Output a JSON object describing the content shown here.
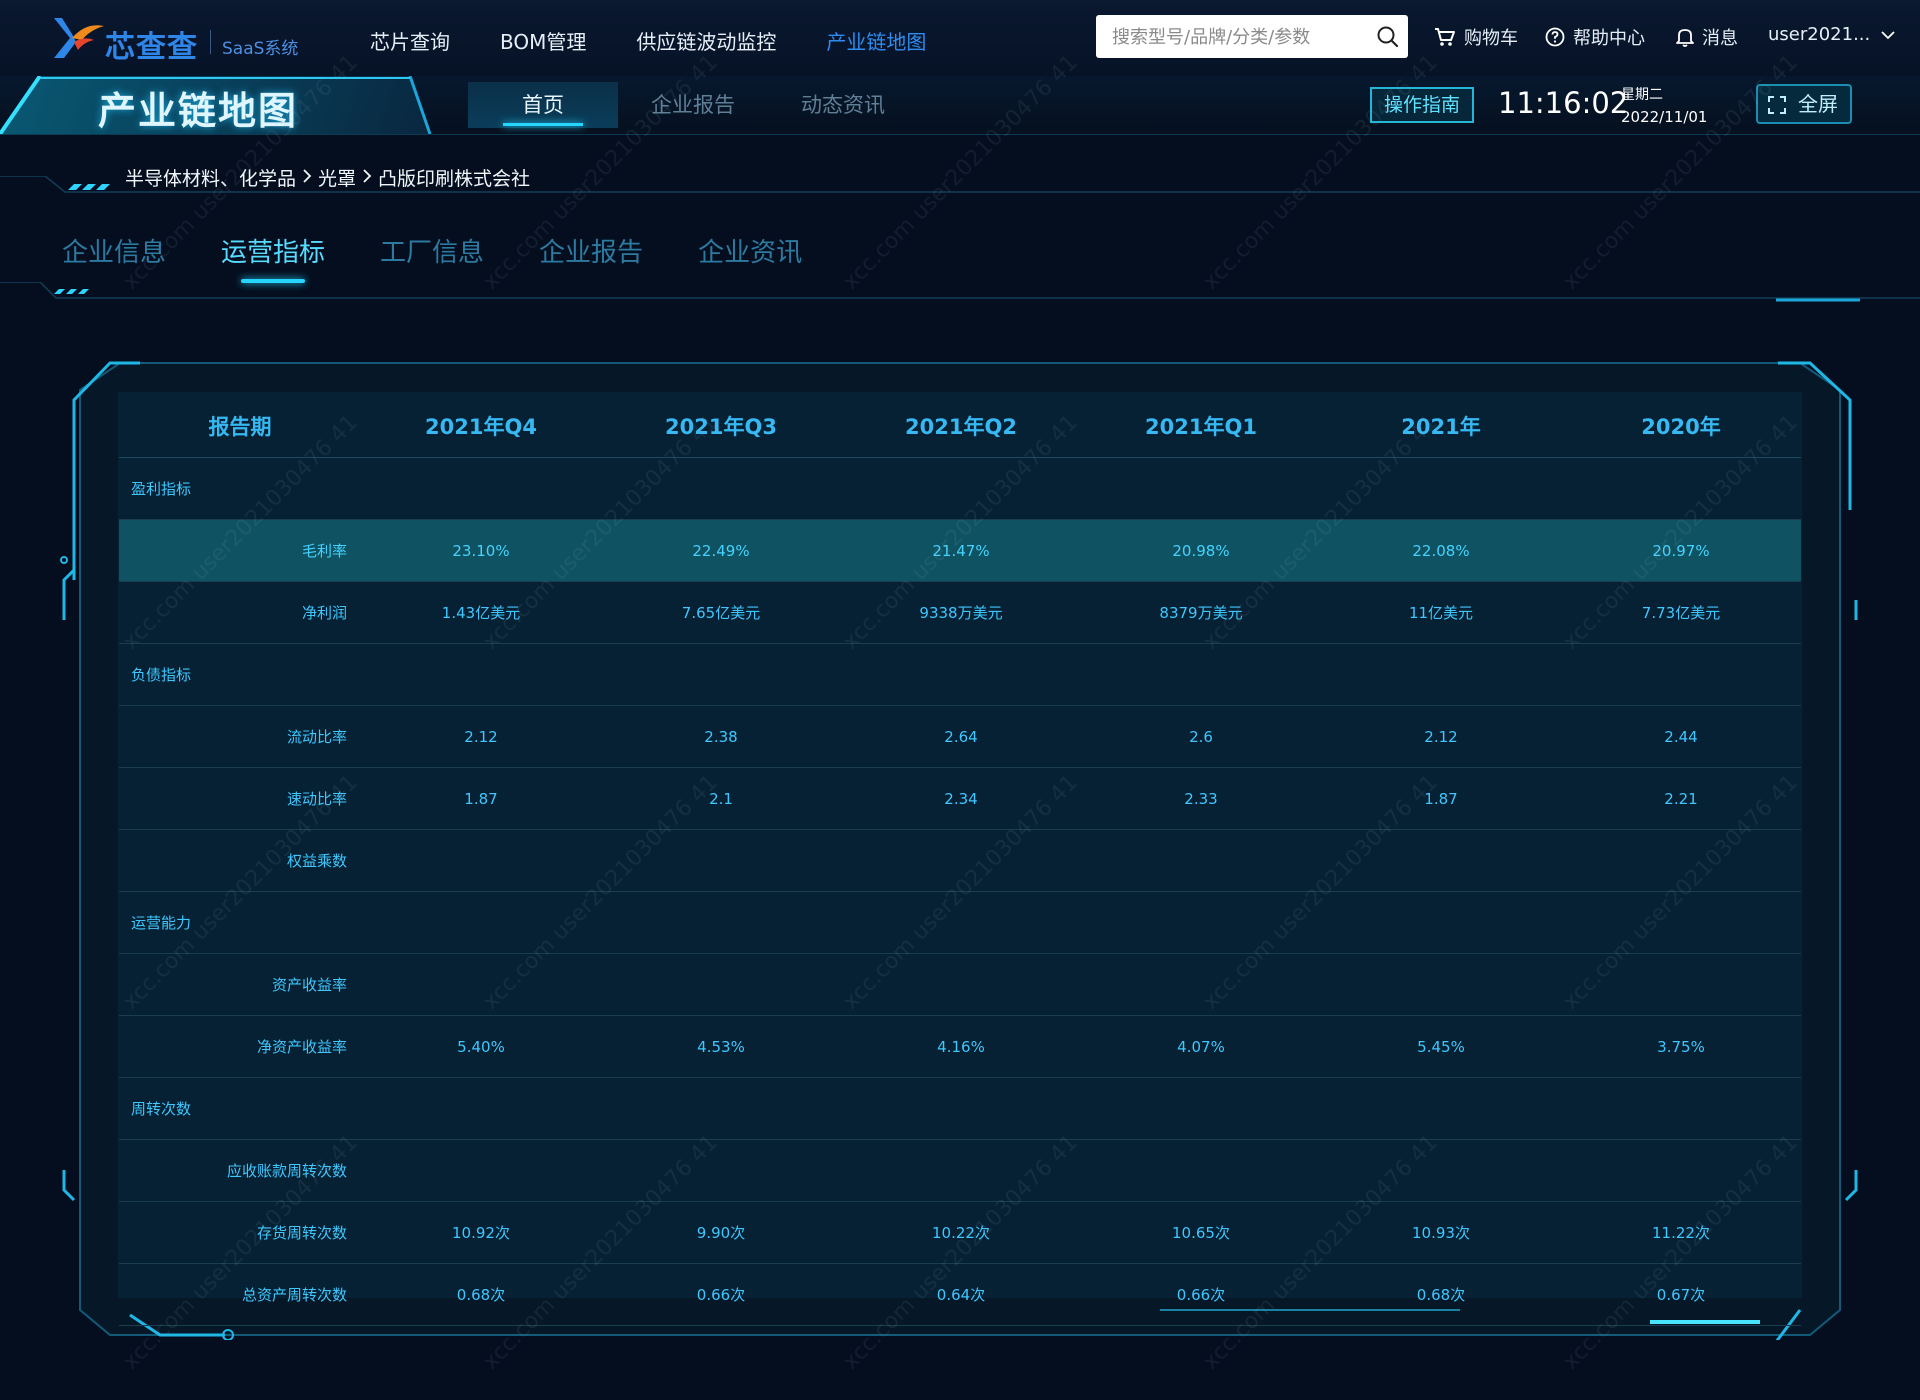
{
  "nav": {
    "brand": "芯查查",
    "brand_sub": "SaaS系统",
    "menu": [
      "芯片查询",
      "BOM管理",
      "供应链波动监控",
      "产业链地图"
    ],
    "active_menu": "产业链地图",
    "search_placeholder": "搜索型号/品牌/分类/参数",
    "cart": "购物车",
    "help": "帮助中心",
    "messages": "消息",
    "user": "user2021..."
  },
  "subheader": {
    "title": "产业链地图",
    "tabs": [
      "首页",
      "企业报告",
      "动态资讯"
    ],
    "active_tab": "首页",
    "guide": "操作指南",
    "time": "11:16:02",
    "weekday": "星期二",
    "date": "2022/11/01",
    "fullscreen": "全屏"
  },
  "breadcrumb": [
    "半导体材料、化学品",
    "光罩",
    "凸版印刷株式会社"
  ],
  "section_tabs": [
    "企业信息",
    "运营指标",
    "工厂信息",
    "企业报告",
    "企业资讯"
  ],
  "active_section": "运营指标",
  "table": {
    "headers": [
      "报告期",
      "2021年Q4",
      "2021年Q3",
      "2021年Q2",
      "2021年Q1",
      "2021年",
      "2020年"
    ],
    "rows": [
      {
        "label": "盈利指标",
        "group": true,
        "values": [
          "",
          "",
          "",
          "",
          "",
          ""
        ]
      },
      {
        "label": "毛利率",
        "group": false,
        "highlight": true,
        "values": [
          "23.10%",
          "22.49%",
          "21.47%",
          "20.98%",
          "22.08%",
          "20.97%"
        ]
      },
      {
        "label": "净利润",
        "group": false,
        "values": [
          "1.43亿美元",
          "7.65亿美元",
          "9338万美元",
          "8379万美元",
          "11亿美元",
          "7.73亿美元"
        ]
      },
      {
        "label": "负债指标",
        "group": true,
        "values": [
          "",
          "",
          "",
          "",
          "",
          ""
        ]
      },
      {
        "label": "流动比率",
        "group": false,
        "values": [
          "2.12",
          "2.38",
          "2.64",
          "2.6",
          "2.12",
          "2.44"
        ]
      },
      {
        "label": "速动比率",
        "group": false,
        "values": [
          "1.87",
          "2.1",
          "2.34",
          "2.33",
          "1.87",
          "2.21"
        ]
      },
      {
        "label": "权益乘数",
        "group": false,
        "values": [
          "",
          "",
          "",
          "",
          "",
          ""
        ]
      },
      {
        "label": "运营能力",
        "group": true,
        "values": [
          "",
          "",
          "",
          "",
          "",
          ""
        ]
      },
      {
        "label": "资产收益率",
        "group": false,
        "values": [
          "",
          "",
          "",
          "",
          "",
          ""
        ]
      },
      {
        "label": "净资产收益率",
        "group": false,
        "values": [
          "5.40%",
          "4.53%",
          "4.16%",
          "4.07%",
          "5.45%",
          "3.75%"
        ]
      },
      {
        "label": "周转次数",
        "group": true,
        "values": [
          "",
          "",
          "",
          "",
          "",
          ""
        ]
      },
      {
        "label": "应收账款周转次数",
        "group": false,
        "values": [
          "",
          "",
          "",
          "",
          "",
          ""
        ]
      },
      {
        "label": "存货周转次数",
        "group": false,
        "values": [
          "10.92次",
          "9.90次",
          "10.22次",
          "10.65次",
          "10.93次",
          "11.22次"
        ]
      },
      {
        "label": "总资产周转次数",
        "group": false,
        "values": [
          "0.68次",
          "0.66次",
          "0.64次",
          "0.66次",
          "0.68次",
          "0.67次"
        ]
      }
    ]
  },
  "watermark": "xcc.com user2021030476 41",
  "colors": {
    "accent": "#27d6ff",
    "menu_active": "#2e8cf0",
    "header_text": "#36b8f2",
    "cell_text": "#3fc7ff",
    "highlight_row": "#0f5362",
    "background": "#040e1f"
  }
}
